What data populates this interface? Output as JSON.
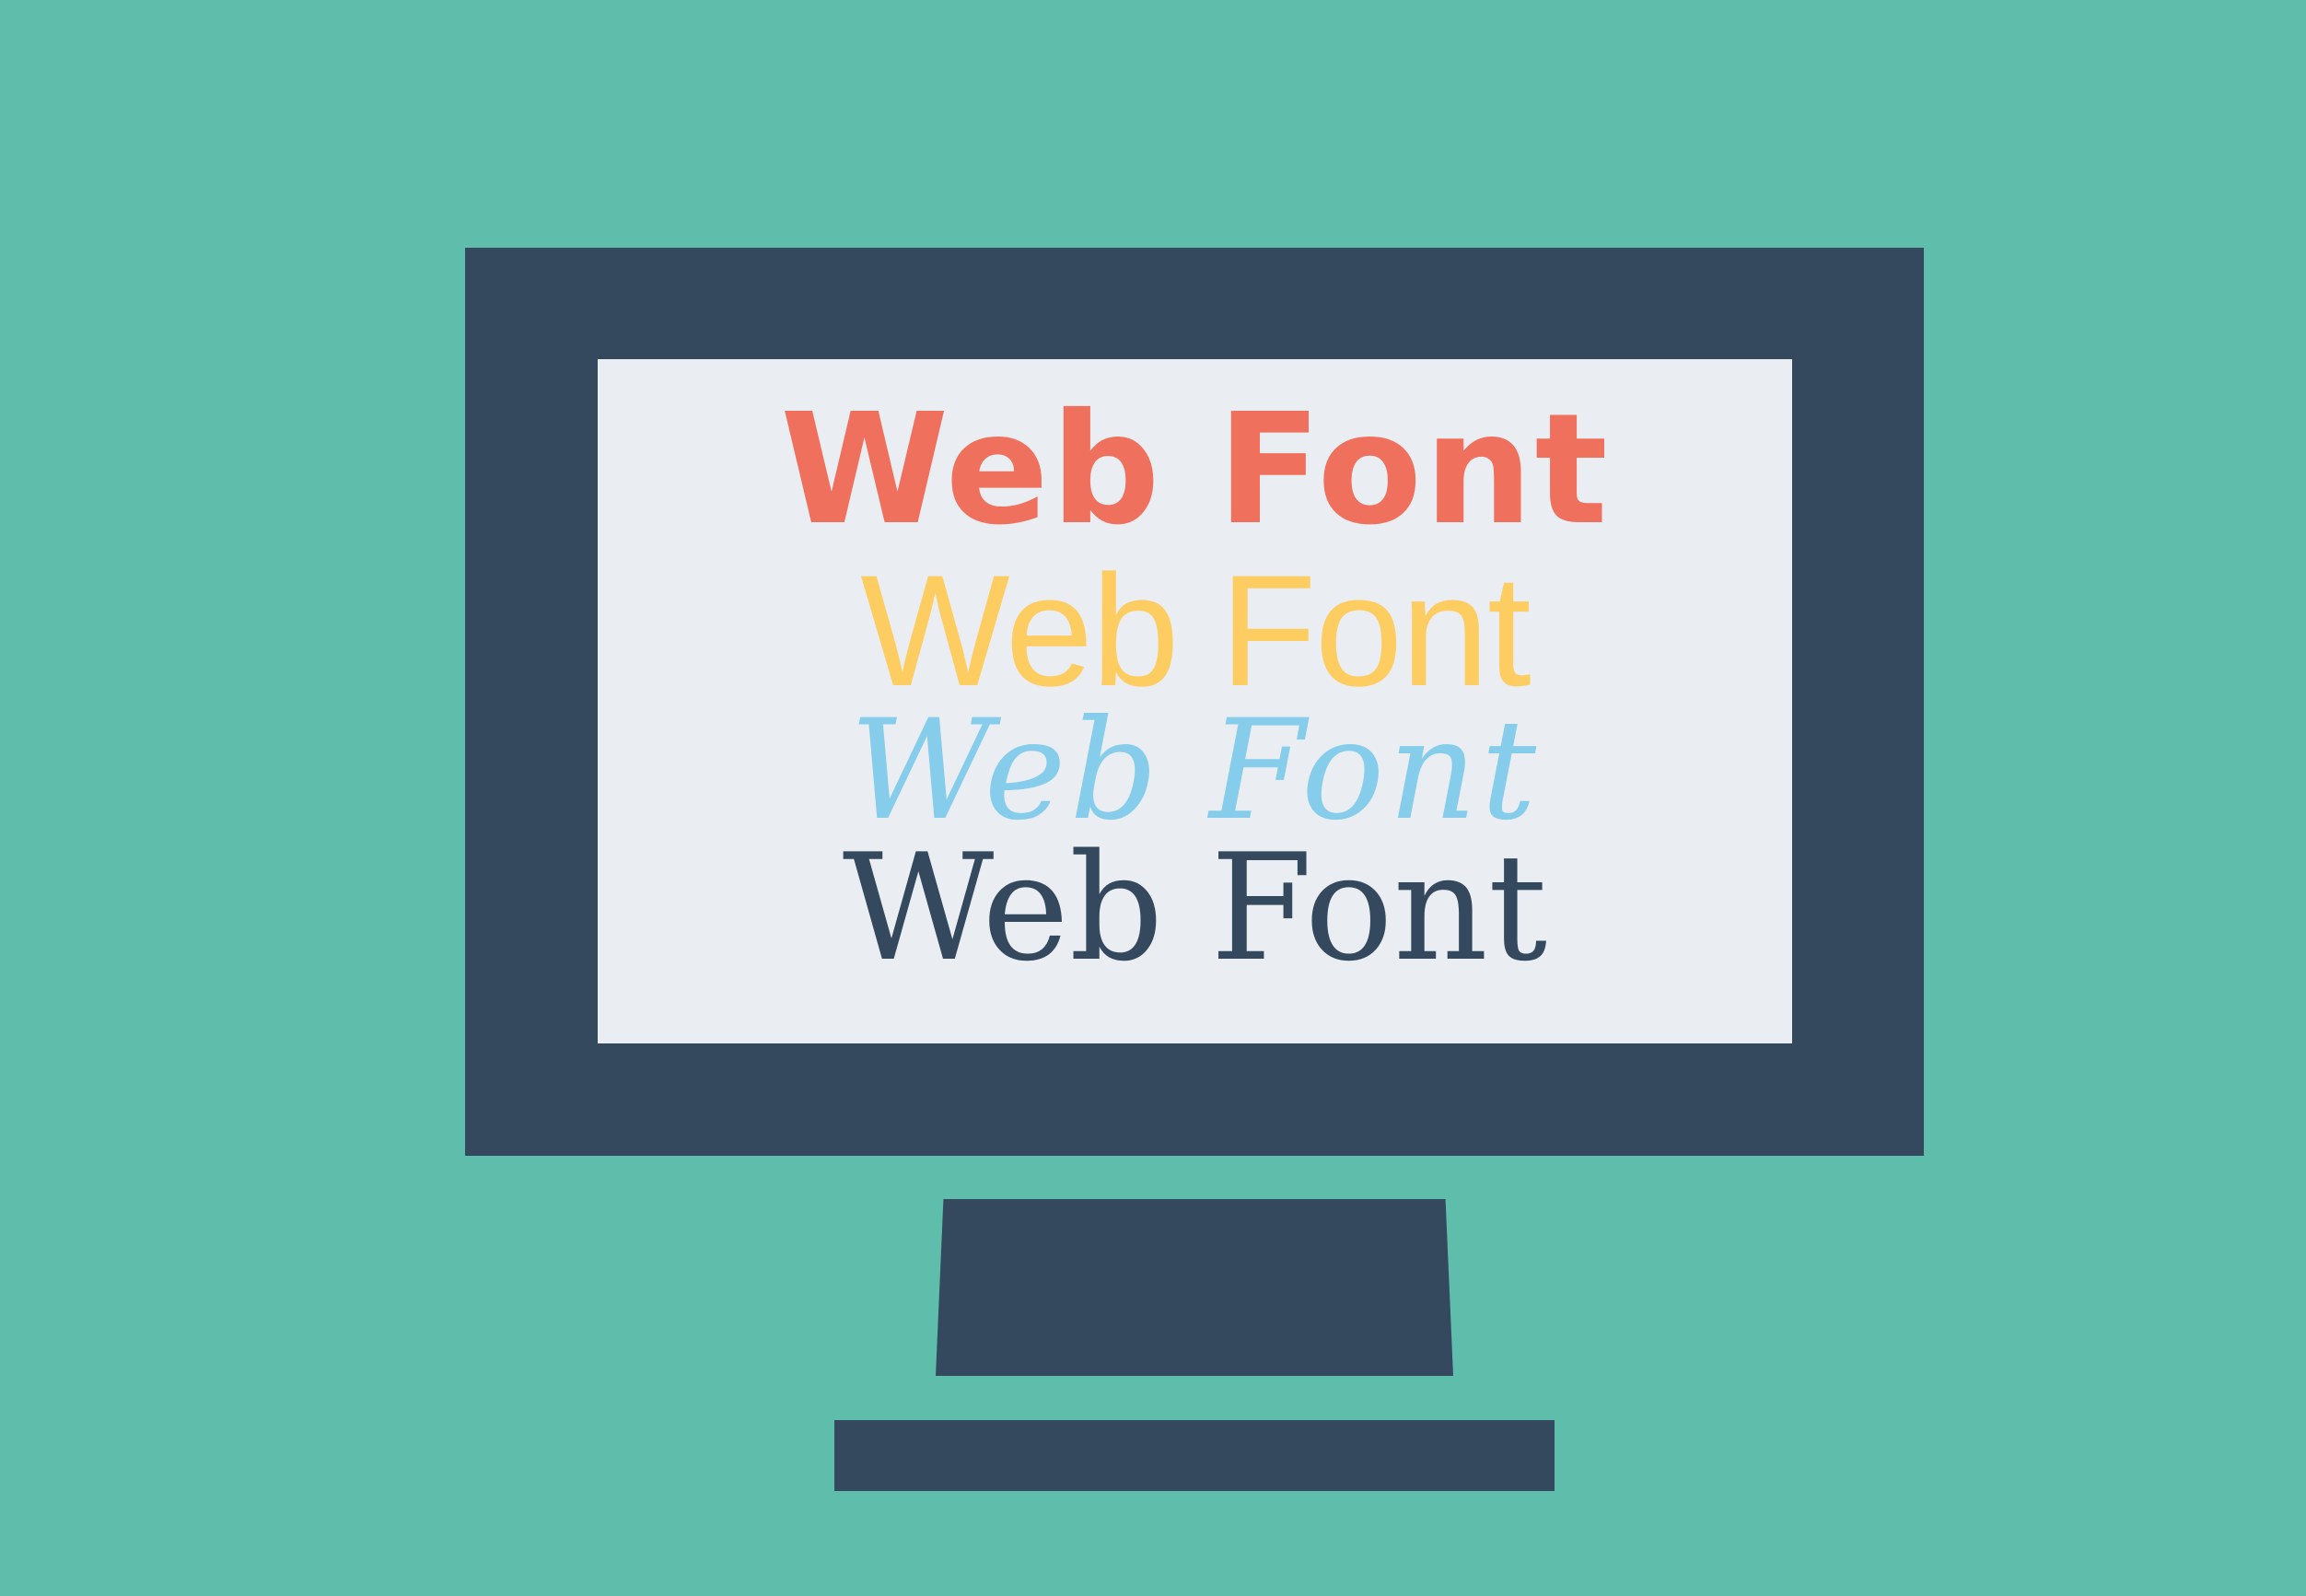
{
  "scene": {
    "background_color": "#5fbdac",
    "monitor_color": "#35495e",
    "screen_color": "#eaedf2"
  },
  "font_samples": [
    {
      "text": "Web Font",
      "color": "#ef705c"
    },
    {
      "text": "Web Font",
      "color": "#fdcd62"
    },
    {
      "text": "Web Font",
      "color": "#86cdeb"
    },
    {
      "text": "Web Font",
      "color": "#35495e"
    }
  ]
}
